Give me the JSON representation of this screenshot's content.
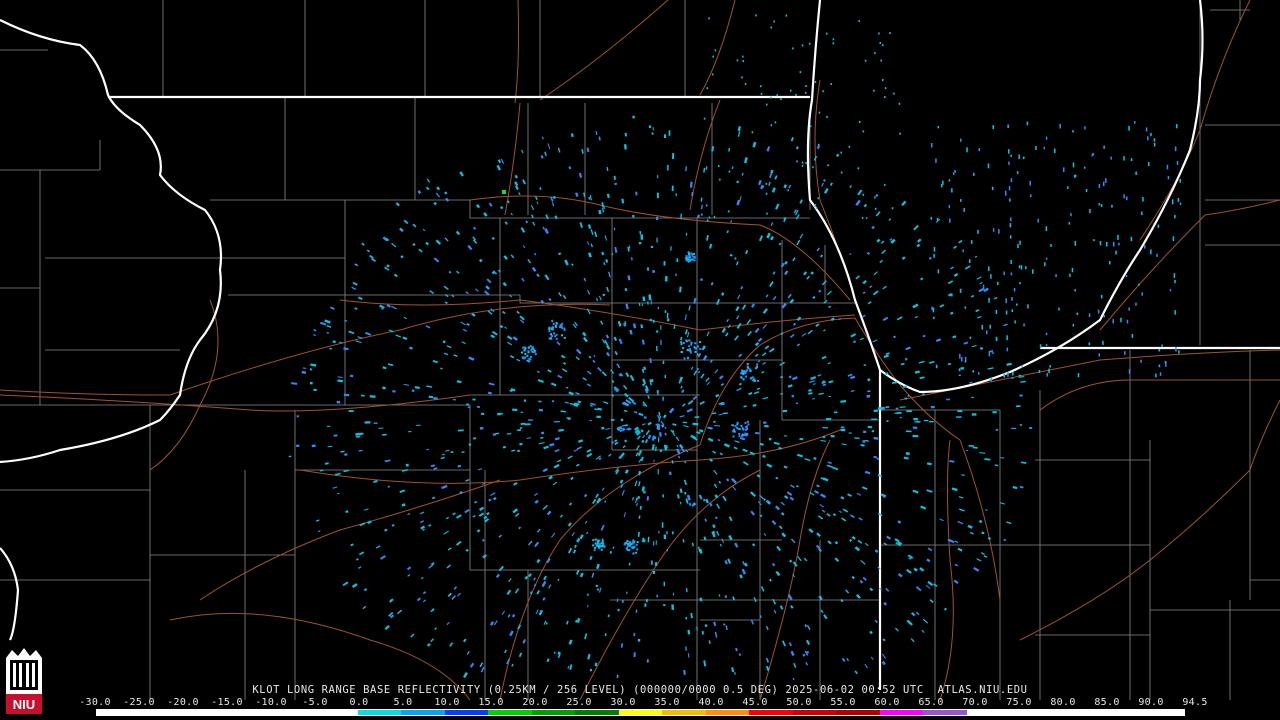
{
  "product": {
    "title": "KLOT LONG RANGE BASE REFLECTIVITY (0.25KM / 256 LEVEL) (000000/0000 0.5 DEG) 2025-06-02 00:52 UTC  ATLAS.NIU.EDU"
  },
  "scale": {
    "labels": [
      "-30.0",
      "-25.0",
      "-20.0",
      "-15.0",
      "-10.0",
      "-5.0",
      "0.0",
      "5.0",
      "10.0",
      "15.0",
      "20.0",
      "25.0",
      "30.0",
      "35.0",
      "40.0",
      "45.0",
      "50.0",
      "55.0",
      "60.0",
      "65.0",
      "70.0",
      "75.0",
      "80.0",
      "85.0",
      "90.0",
      "94.5"
    ],
    "colors": [
      "#ffffff",
      "#ffffff",
      "#ffffff",
      "#ffffff",
      "#ffffff",
      "#ffffff",
      "#00e0e0",
      "#00a8f0",
      "#0040ff",
      "#00d000",
      "#00a000",
      "#008000",
      "#ffff00",
      "#f0c000",
      "#ff9000",
      "#ff0000",
      "#d00000",
      "#b00000",
      "#ff00ff",
      "#9955cc",
      "#ffffff",
      "#ffffff",
      "#ffffff",
      "#ffffff",
      "#ffffff"
    ]
  },
  "logo": {
    "text": "NIU",
    "color": "#c8102e"
  },
  "map_colors": {
    "background": "#000000",
    "state_borders": "#ffffff",
    "county_lines": "#8a8a8a",
    "highways": "#a0522d",
    "echo_light": "#00c8e8",
    "echo_mid": "#2e8bff",
    "echo_green": "#00e040"
  }
}
